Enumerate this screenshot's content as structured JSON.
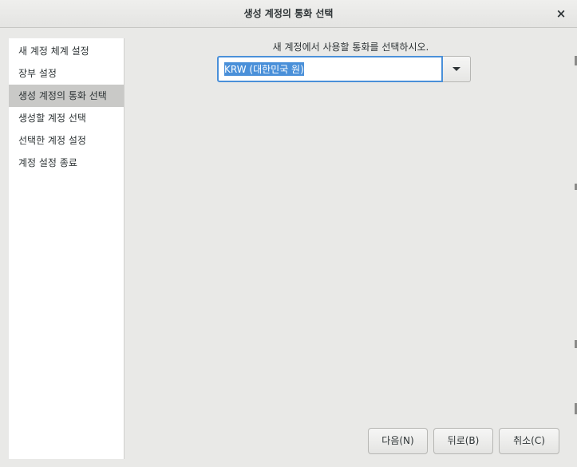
{
  "window": {
    "title": "생성 계정의 통화 선택",
    "close_label": "×"
  },
  "sidebar": {
    "items": [
      {
        "label": "새 계정 체계 설정"
      },
      {
        "label": "장부 설정"
      },
      {
        "label": "생성 계정의 통화 선택",
        "selected": true
      },
      {
        "label": "생성할 계정 선택"
      },
      {
        "label": "선택한 계정 설정"
      },
      {
        "label": "계정 설정 종료"
      }
    ]
  },
  "main": {
    "prompt": "새 계정에서 사용할 통화를 선택하시오.",
    "currency": {
      "value": "KRW (대한민국 원)"
    }
  },
  "buttons": {
    "next": "다음(N)",
    "back": "뒤로(B)",
    "cancel": "취소(C)"
  },
  "icons": {
    "close": "close-icon",
    "dropdown": "chevron-down-icon"
  },
  "colors": {
    "accent": "#4a90d9",
    "selected_bg": "#c9c9c7"
  }
}
